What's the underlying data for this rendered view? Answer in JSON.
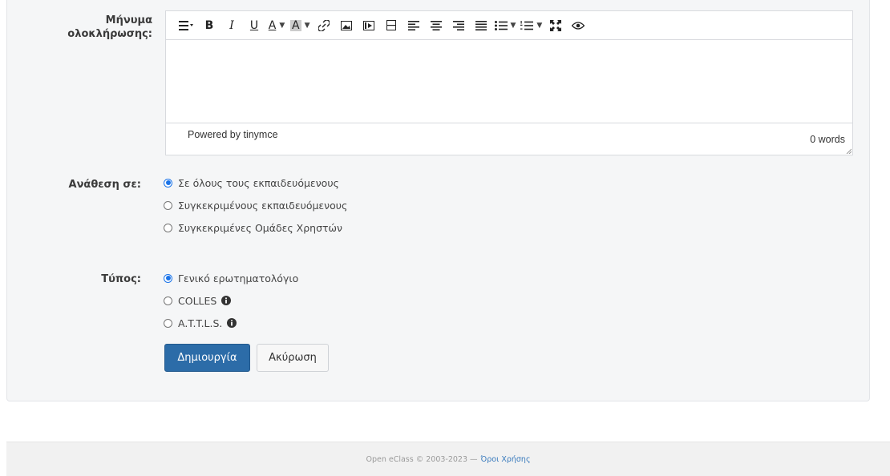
{
  "form": {
    "completion_message_label": "Μήνυμα ολοκλήρωσης:",
    "assign_to_label": "Ανάθεση σε:",
    "type_label": "Τύπος:"
  },
  "editor": {
    "powered_by": "Powered by tinymce",
    "word_count": "0 words",
    "toolbar_icons": [
      "paragraph-icon",
      "bold-icon",
      "italic-icon",
      "underline-icon",
      "text-color-icon",
      "background-color-icon",
      "link-icon",
      "image-icon",
      "media-icon",
      "template-icon",
      "align-left-icon",
      "align-center-icon",
      "align-right-icon",
      "align-justify-icon",
      "bullet-list-icon",
      "numbered-list-icon",
      "fullscreen-icon",
      "preview-icon"
    ],
    "bold_glyph": "B",
    "italic_glyph": "I",
    "underline_glyph": "U",
    "text_color_glyph": "A",
    "bg_color_glyph": "A"
  },
  "assign_options": [
    {
      "label": "Σε όλους τους εκπαιδευόμενους",
      "checked": true
    },
    {
      "label": "Συγκεκριμένους εκπαιδευόμενους",
      "checked": false
    },
    {
      "label": "Συγκεκριμένες Ομάδες Χρηστών",
      "checked": false
    }
  ],
  "type_options": [
    {
      "label": "Γενικό ερωτηματολόγιο",
      "checked": true,
      "info": false
    },
    {
      "label": "COLLES",
      "checked": false,
      "info": true
    },
    {
      "label": "A.T.T.L.S.",
      "checked": false,
      "info": true
    }
  ],
  "buttons": {
    "create": "Δημιουργία",
    "cancel": "Ακύρωση"
  },
  "footer": {
    "copyright": "Open eClass © 2003-2023 —",
    "terms_link": "Όροι Χρήσης"
  },
  "colors": {
    "primary_button": "#2c6ca8",
    "radio_checked": "#1a73e8",
    "footer_link": "#3a7bbd"
  }
}
